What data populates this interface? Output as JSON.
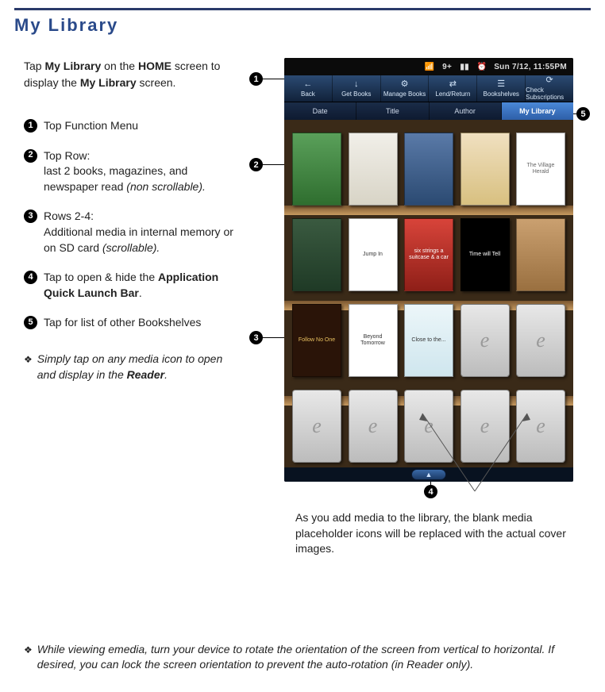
{
  "page": {
    "title": "My Library"
  },
  "intro": {
    "pre": "Tap ",
    "b1": "My Library",
    "mid": " on the ",
    "b2": "HOME",
    "mid2": " screen to display the ",
    "b3": "My Library",
    "post": " screen."
  },
  "callouts": {
    "1": {
      "text": "Top Function Menu"
    },
    "2": {
      "lead": "Top Row:",
      "text": "last 2 books, magazines, and newspaper read ",
      "em": "(non scrollable)."
    },
    "3": {
      "lead": "Rows 2-4:",
      "text": "Additional media in internal memory or on SD card ",
      "em": "(scrollable)."
    },
    "4": {
      "pre": "Tap to open & hide the ",
      "b": "Application Quick Launch Bar",
      "post": "."
    },
    "5": {
      "text": "Tap for list of other Bookshelves"
    }
  },
  "tips": {
    "a": {
      "pre": "Simply tap on any media icon to open and display in the ",
      "b": "Reader",
      "post": "."
    },
    "b": "While viewing emedia, turn your device to rotate the orientation of the screen from vertical to horizontal. If desired, you can lock the screen orientation to prevent the auto-rotation (in Reader only)."
  },
  "caption": "As you add media to the library, the blank media placeholder icons will be replaced with the actual cover images.",
  "statusbar": {
    "wifi": "▶",
    "signal": "▮▮",
    "battery": "▯",
    "notif": "9+",
    "alarm": "⏰",
    "time": "Sun 7/12, 11:55PM"
  },
  "toolbar": [
    {
      "icon": "←",
      "label": "Back"
    },
    {
      "icon": "↓",
      "label": "Get Books"
    },
    {
      "icon": "⚙",
      "label": "Manage Books"
    },
    {
      "icon": "⇄",
      "label": "Lend/Return"
    },
    {
      "icon": "☰",
      "label": "Bookshelves"
    },
    {
      "icon": "⟳",
      "label": "Check Subscriptions"
    }
  ],
  "sortbar": [
    {
      "label": "Date",
      "active": false
    },
    {
      "label": "Title",
      "active": false
    },
    {
      "label": "Author",
      "active": false
    },
    {
      "label": "My Library",
      "active": true
    }
  ],
  "shelves": [
    [
      {
        "title": "",
        "cls": "bk-a"
      },
      {
        "title": "",
        "cls": "bk-b"
      },
      {
        "title": "",
        "cls": "bk-c"
      },
      {
        "title": "",
        "cls": "bk-d"
      },
      {
        "title": "The Village Herald",
        "cls": "bk-e"
      }
    ],
    [
      {
        "title": "",
        "cls": "bk-f"
      },
      {
        "title": "Jump In",
        "cls": "bk-g"
      },
      {
        "title": "six strings a suitcase & a car",
        "cls": "bk-h"
      },
      {
        "title": "Time will Tell",
        "cls": "bk-i"
      },
      {
        "title": "",
        "cls": "bk-j"
      }
    ],
    [
      {
        "title": "Follow No One",
        "cls": "bk-k"
      },
      {
        "title": "Beyond Tomorrow",
        "cls": "bk-l"
      },
      {
        "title": "Close to the...",
        "cls": "bk-m"
      },
      {
        "placeholder": true
      },
      {
        "placeholder": true
      }
    ],
    [
      {
        "placeholder": true
      },
      {
        "placeholder": true
      },
      {
        "placeholder": true
      },
      {
        "placeholder": true
      },
      {
        "placeholder": true
      }
    ]
  ],
  "handle_icon": "▲"
}
